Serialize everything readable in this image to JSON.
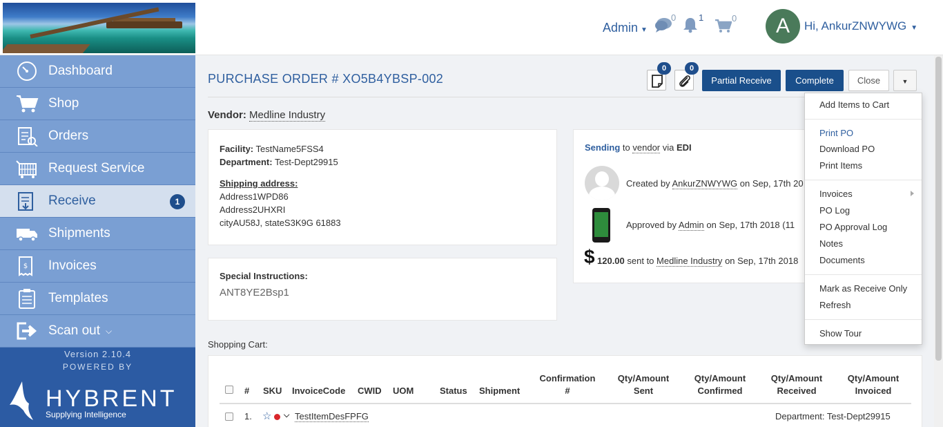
{
  "header": {
    "admin_label": "Admin",
    "messages_count": "0",
    "notifications_count": "1",
    "cart_count": "0",
    "avatar_letter": "A",
    "greeting": "Hi, AnkurZNWYWG"
  },
  "sidebar": {
    "items": [
      {
        "label": "Dashboard",
        "icon": "dashboard-icon"
      },
      {
        "label": "Shop",
        "icon": "cart-icon"
      },
      {
        "label": "Orders",
        "icon": "orders-icon"
      },
      {
        "label": "Request Service",
        "icon": "request-service-icon"
      },
      {
        "label": "Receive",
        "icon": "receive-icon",
        "badge": "1"
      },
      {
        "label": "Shipments",
        "icon": "truck-icon"
      },
      {
        "label": "Invoices",
        "icon": "invoice-icon"
      },
      {
        "label": "Templates",
        "icon": "templates-icon"
      },
      {
        "label": "Scan out",
        "icon": "scan-out-icon"
      }
    ],
    "version": "Version 2.10.4",
    "powered_by": "POWERED BY",
    "brand": "HYBRENT",
    "tagline": "Supplying Intelligence"
  },
  "page": {
    "title": "PURCHASE ORDER # XO5B4YBSP-002",
    "notes_badge": "0",
    "attachments_badge": "0",
    "partial_receive": "Partial Receive",
    "complete": "Complete",
    "close": "Close",
    "vendor_label": "Vendor:",
    "vendor_name": "Medline Industry"
  },
  "facility_card": {
    "facility_label": "Facility:",
    "facility_value": "TestName5FSS4",
    "department_label": "Department:",
    "department_value": "Test-Dept29915",
    "shipping_label": "Shipping address:",
    "address1": "Address1WPD86",
    "address2": "Address2UHXRI",
    "address3": "cityAU58J, stateS3K9G 61883"
  },
  "instructions_card": {
    "label": "Special Instructions:",
    "value": "ANT8YE2Bsp1"
  },
  "activity": {
    "sending": "Sending",
    "sending_to": "to",
    "sending_vendor": "vendor",
    "sending_via": "via",
    "sending_method": "EDI",
    "created_prefix": "Created by",
    "created_user": "AnkurZNWYWG",
    "created_suffix": "on Sep, 17th 20",
    "approved_prefix": "Approved by",
    "approved_user": "Admin",
    "approved_suffix": "on Sep, 17th 2018 (11",
    "amount": "120.00",
    "sent_prefix": "sent to",
    "sent_vendor": "Medline Industry",
    "sent_suffix": "on Sep, 17th 2018"
  },
  "cart": {
    "label": "Shopping Cart:",
    "columns": {
      "num": "#",
      "sku": "SKU",
      "invoice_code": "InvoiceCode",
      "cwid": "CWID",
      "uom": "UOM",
      "status": "Status",
      "shipment": "Shipment",
      "confirmation_1": "Confirmation",
      "confirmation_2": "#",
      "qty_sent_1": "Qty/Amount",
      "qty_sent_2": "Sent",
      "qty_confirmed_1": "Qty/Amount",
      "qty_confirmed_2": "Confirmed",
      "qty_received_1": "Qty/Amount",
      "qty_received_2": "Received",
      "qty_invoiced_1": "Qty/Amount",
      "qty_invoiced_2": "Invoiced"
    },
    "row": {
      "num": "1.",
      "item": "TestItemDesFPFG",
      "department": "Department: Test-Dept29915"
    }
  },
  "dropdown": {
    "add_to_cart": "Add Items to Cart",
    "print_po": "Print PO",
    "download_po": "Download PO",
    "print_items": "Print Items",
    "invoices": "Invoices",
    "po_log": "PO Log",
    "po_approval_log": "PO Approval Log",
    "notes": "Notes",
    "documents": "Documents",
    "mark_receive_only": "Mark as Receive Only",
    "refresh": "Refresh",
    "show_tour": "Show Tour"
  },
  "colors": {
    "brand_blue": "#2f5f9f",
    "primary_button": "#1a4f8b",
    "sidebar_item": "#7a9fd3",
    "sidebar_active": "#d4dfee",
    "sidebar_bg": "#2c5ba3"
  }
}
